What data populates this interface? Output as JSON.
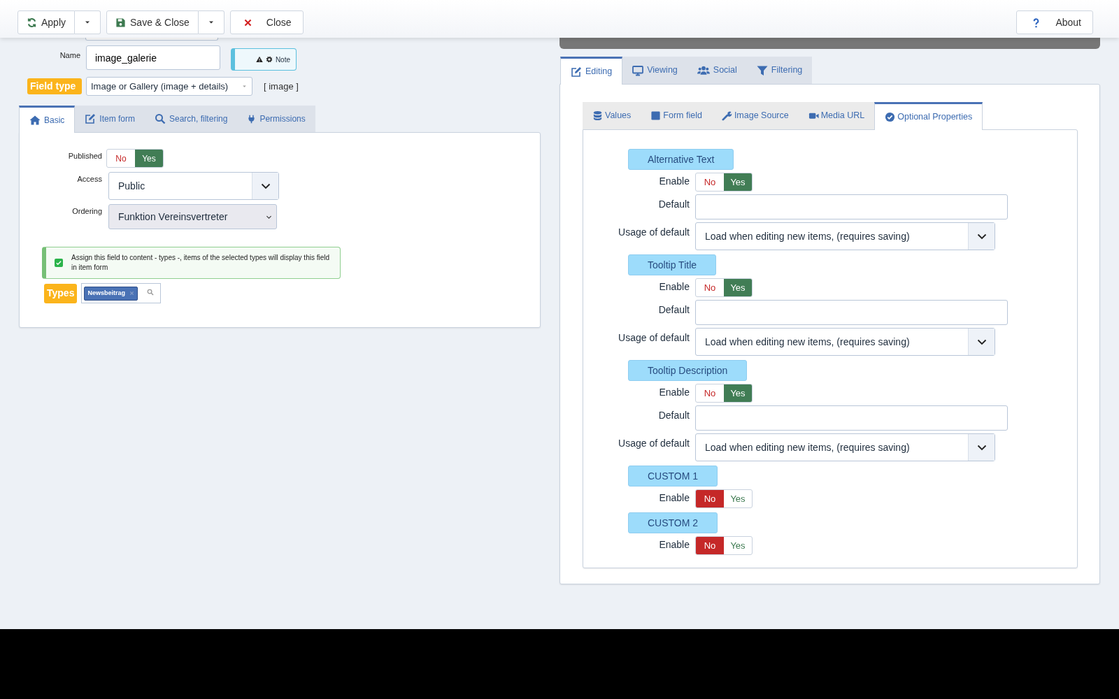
{
  "toolbar": {
    "buttons": [
      {
        "label": "Apply",
        "kind": "split"
      },
      {
        "label": "Save & Close",
        "kind": "split"
      },
      {
        "label": "Close",
        "kind": "plain"
      }
    ],
    "about": "About"
  },
  "left": {
    "name": {
      "label": "Name",
      "value": "image_galerie"
    },
    "note": "Note",
    "field_type": {
      "label": "Field type",
      "value": "Image or Gallery (image + details)",
      "code": "[ image ]"
    },
    "tabs": [
      {
        "label": "Basic",
        "selected": true
      },
      {
        "label": "Item form",
        "selected": false
      },
      {
        "label": "Search, filtering",
        "selected": false
      },
      {
        "label": "Permissions",
        "selected": false
      }
    ],
    "published": {
      "label": "Published",
      "options": [
        {
          "label": "No",
          "selected": false
        },
        {
          "label": "Yes",
          "selected": true
        }
      ]
    },
    "access": {
      "label": "Access",
      "value": "Public"
    },
    "ordering": {
      "label": "Ordering",
      "value": "Funktion Vereinsvertreter"
    },
    "assign": {
      "checked": true,
      "text": "Assign this field to content - types -, items of the selected types will display this field in item form"
    },
    "types": {
      "label": "Types",
      "tags": [
        "Newsbeitrag"
      ]
    }
  },
  "right": {
    "tabs": [
      {
        "label": "Editing",
        "selected": true
      },
      {
        "label": "Viewing",
        "selected": false
      },
      {
        "label": "Social",
        "selected": false
      },
      {
        "label": "Filtering",
        "selected": false
      }
    ],
    "subtabs": [
      {
        "label": "Values",
        "selected": false
      },
      {
        "label": "Form field",
        "selected": false
      },
      {
        "label": "Image Source",
        "selected": false
      },
      {
        "label": "Media URL",
        "selected": false
      },
      {
        "label": "Optional Properties",
        "selected": true
      }
    ],
    "groups": [
      {
        "title": "Alternative Text",
        "rows": [
          {
            "kind": "toggle",
            "label": "Enable",
            "options": [
              {
                "label": "No",
                "selected": false
              },
              {
                "label": "Yes",
                "selected": true
              }
            ]
          },
          {
            "kind": "input",
            "label": "Default"
          },
          {
            "kind": "select",
            "label": "Usage of default",
            "value": "Load when editing new items, (requires saving)"
          }
        ]
      },
      {
        "title": "Tooltip Title",
        "rows": [
          {
            "kind": "toggle",
            "label": "Enable",
            "options": [
              {
                "label": "No",
                "selected": false
              },
              {
                "label": "Yes",
                "selected": true
              }
            ]
          },
          {
            "kind": "input",
            "label": "Default"
          },
          {
            "kind": "select",
            "label": "Usage of default",
            "value": "Load when editing new items, (requires saving)"
          }
        ]
      },
      {
        "title": "Tooltip Description",
        "rows": [
          {
            "kind": "toggle",
            "label": "Enable",
            "options": [
              {
                "label": "No",
                "selected": false
              },
              {
                "label": "Yes",
                "selected": true
              }
            ]
          },
          {
            "kind": "input",
            "label": "Default"
          },
          {
            "kind": "select",
            "label": "Usage of default",
            "value": "Load when editing new items, (requires saving)"
          }
        ]
      },
      {
        "title": "CUSTOM 1",
        "rows": [
          {
            "kind": "toggle",
            "label": "Enable",
            "options": [
              {
                "label": "No",
                "selected": true
              },
              {
                "label": "Yes",
                "selected": false
              }
            ]
          }
        ]
      },
      {
        "title": "CUSTOM 2",
        "rows": [
          {
            "kind": "toggle",
            "label": "Enable",
            "options": [
              {
                "label": "No",
                "selected": true
              },
              {
                "label": "Yes",
                "selected": false
              }
            ]
          }
        ]
      }
    ]
  }
}
